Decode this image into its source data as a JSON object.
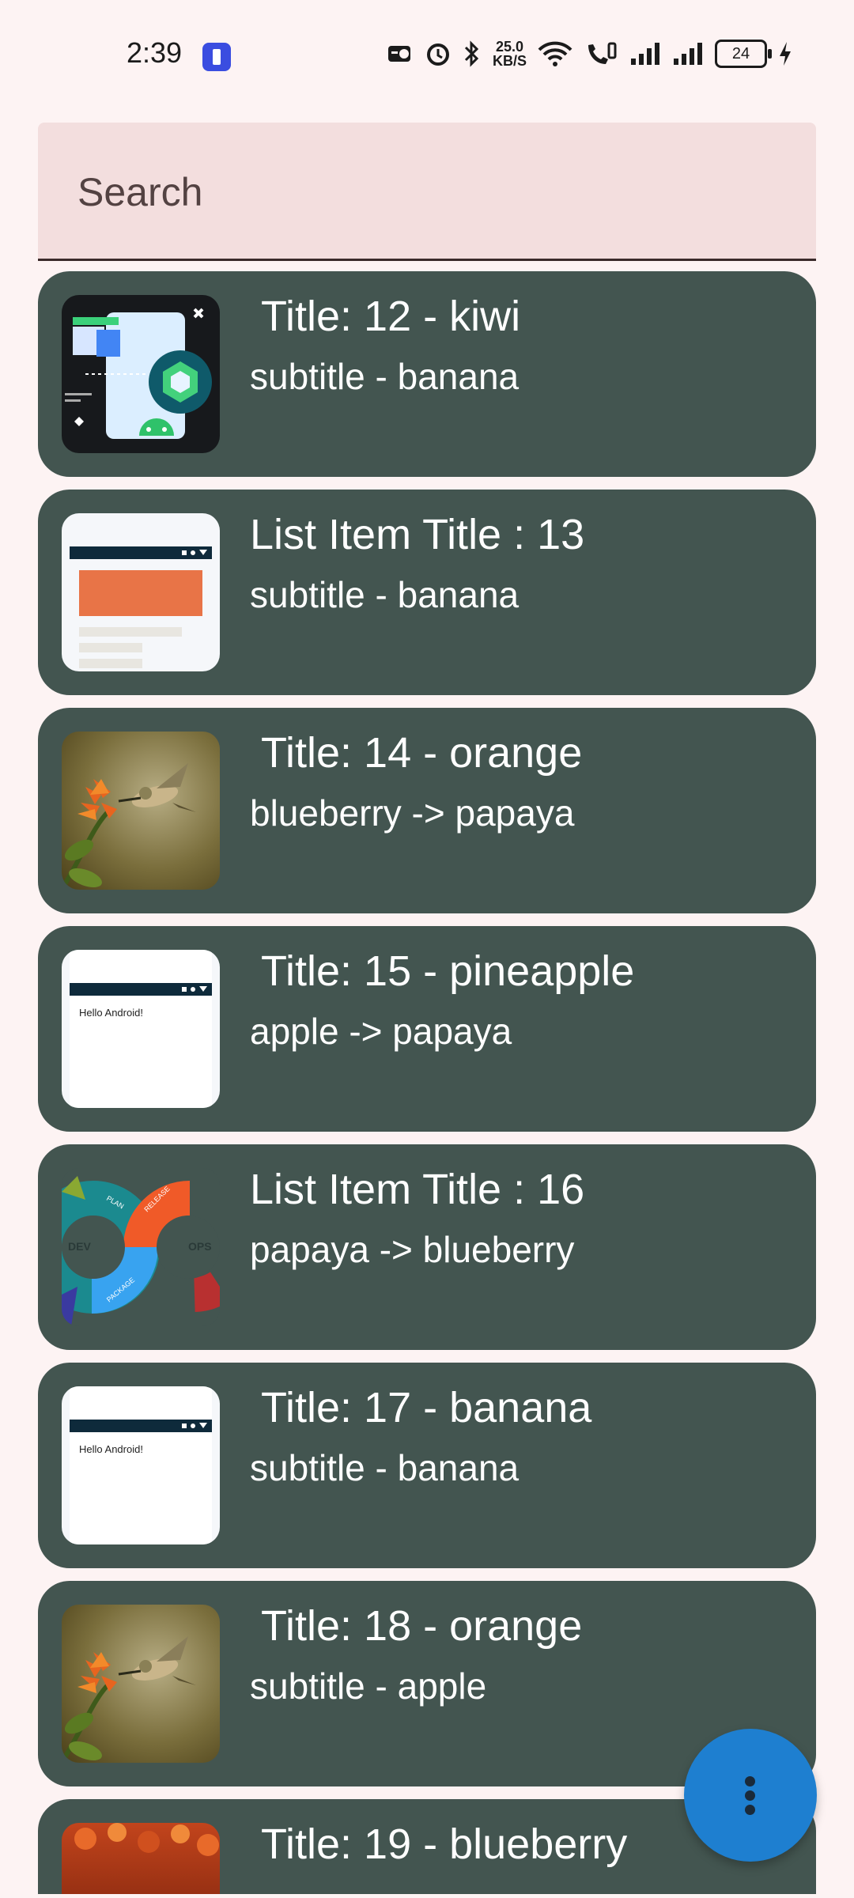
{
  "status_bar": {
    "time": "2:39",
    "net_speed_value": "25.0",
    "net_speed_unit": "KB/S",
    "battery": "24"
  },
  "search": {
    "placeholder": "Search",
    "value": ""
  },
  "items": [
    {
      "title": " Title: 12 - kiwi",
      "subtitle": "subtitle - banana",
      "image": "compose-android-illustration"
    },
    {
      "title": "List Item Title : 13",
      "subtitle": "subtitle - banana",
      "image": "app-screen-orange-mockup"
    },
    {
      "title": " Title: 14 - orange",
      "subtitle": "blueberry -> papaya",
      "image": "hummingbird-photo"
    },
    {
      "title": " Title: 15 - pineapple",
      "subtitle": "apple -> papaya",
      "image": "hello-android-screen"
    },
    {
      "title": "List Item Title : 16",
      "subtitle": "papaya -> blueberry",
      "image": "devops-cycle-diagram"
    },
    {
      "title": " Title: 17 - banana",
      "subtitle": "subtitle - banana",
      "image": "hello-android-screen"
    },
    {
      "title": " Title: 18 - orange",
      "subtitle": "subtitle - apple",
      "image": "hummingbird-photo"
    },
    {
      "title": " Title: 19 - blueberry",
      "subtitle": "",
      "image": "autumn-leaves-photo"
    }
  ],
  "thumb_text": {
    "hello_android": "Hello Android!",
    "dev": "DEV",
    "ops": "OPS",
    "plan": "PLAN",
    "release": "RELEASE",
    "package": "PACKAGE"
  },
  "fab": {
    "icon": "more-vert-icon"
  }
}
